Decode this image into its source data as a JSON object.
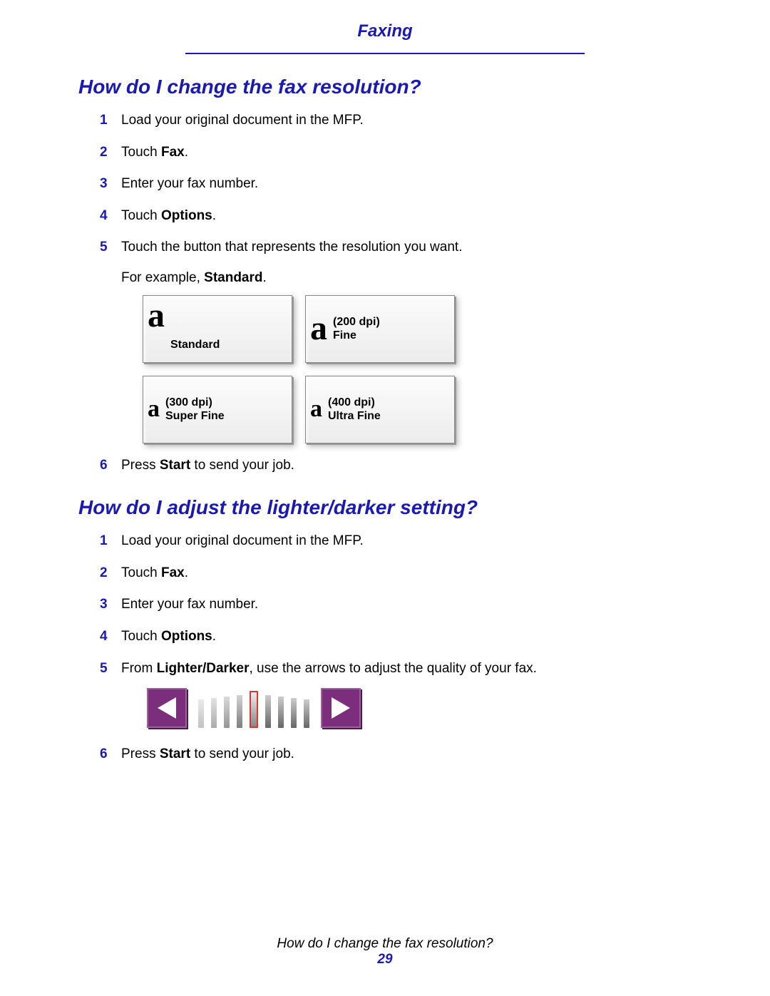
{
  "header": {
    "title": "Faxing"
  },
  "section1": {
    "heading": "How do I change the fax resolution?",
    "steps": [
      {
        "n": "1",
        "text": "Load your original document in the MFP."
      },
      {
        "n": "2",
        "pre": "Touch ",
        "bold": "Fax",
        "post": "."
      },
      {
        "n": "3",
        "text": "Enter your fax number."
      },
      {
        "n": "4",
        "pre": "Touch ",
        "bold": "Options",
        "post": "."
      },
      {
        "n": "5",
        "text": "Touch the button that represents the resolution you want.",
        "sub_pre": "For example, ",
        "sub_bold": "Standard",
        "sub_post": "."
      },
      {
        "n": "6",
        "pre": "Press ",
        "bold": "Start",
        "post": " to send your job."
      }
    ],
    "buttons": [
      {
        "glyph": "a",
        "line1": "",
        "line2": "Standard"
      },
      {
        "glyph": "a",
        "line1": "(200 dpi)",
        "line2": "Fine"
      },
      {
        "glyph": "a",
        "line1": "(300 dpi)",
        "line2": "Super Fine"
      },
      {
        "glyph": "a",
        "line1": "(400 dpi)",
        "line2": "Ultra Fine"
      }
    ]
  },
  "section2": {
    "heading": "How do I adjust the lighter/darker setting?",
    "steps": [
      {
        "n": "1",
        "text": "Load your original document in the MFP."
      },
      {
        "n": "2",
        "pre": "Touch ",
        "bold": "Fax",
        "post": "."
      },
      {
        "n": "3",
        "text": "Enter your fax number."
      },
      {
        "n": "4",
        "pre": "Touch ",
        "bold": "Options",
        "post": "."
      },
      {
        "n": "5",
        "pre": "From ",
        "bold": "Lighter/Darker",
        "post": ", use the arrows to adjust the quality of your fax."
      },
      {
        "n": "6",
        "pre": "Press ",
        "bold": "Start",
        "post": " to send your job."
      }
    ]
  },
  "footer": {
    "title": "How do I change the fax resolution?",
    "page": "29"
  }
}
